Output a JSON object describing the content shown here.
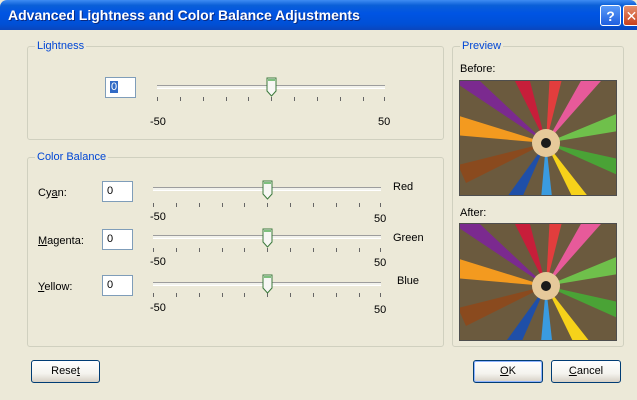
{
  "window": {
    "title": "Advanced Lightness and Color Balance Adjustments",
    "help_glyph": "?",
    "close_glyph": "✕"
  },
  "lightness": {
    "group_label": "Lightness",
    "value": "0",
    "min_label": "-50",
    "max_label": "50",
    "slider_value": 0
  },
  "color_balance": {
    "group_label": "Color Balance",
    "rows": [
      {
        "label_pre": "Cy",
        "label_key": "a",
        "label_post": "n:",
        "value": "0",
        "right_label": "Red",
        "min_label": "-50",
        "max_label": "50",
        "slider_value": 0
      },
      {
        "label_pre": "",
        "label_key": "M",
        "label_post": "agenta:",
        "value": "0",
        "right_label": "Green",
        "min_label": "-50",
        "max_label": "50",
        "slider_value": 0
      },
      {
        "label_pre": "",
        "label_key": "Y",
        "label_post": "ellow:",
        "value": "0",
        "right_label": "Blue",
        "min_label": "-50",
        "max_label": "50",
        "slider_value": 0
      }
    ]
  },
  "preview": {
    "group_label": "Preview",
    "before_label": "Before:",
    "after_label": "After:"
  },
  "buttons": {
    "reset_pre": "Rese",
    "reset_key": "t",
    "reset_post": "",
    "ok_key": "O",
    "ok_post": "K",
    "cancel_key": "C",
    "cancel_post": "ancel"
  },
  "colors": {
    "group_label": "#0046d5",
    "dialog_bg": "#ece9d8",
    "titlebar": "#0054e3"
  },
  "icons": [
    "help-icon",
    "close-icon",
    "slider-thumb-icon"
  ]
}
